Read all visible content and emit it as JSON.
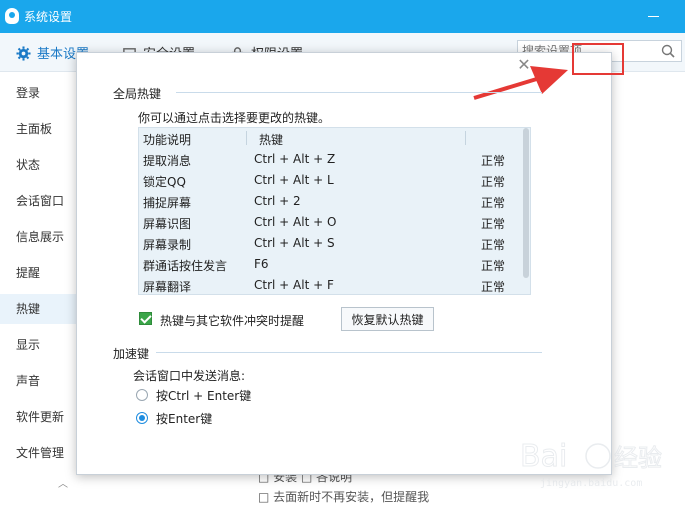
{
  "window": {
    "title": "系统设置"
  },
  "tabs": [
    {
      "label": "基本设置"
    },
    {
      "label": "安全设置"
    },
    {
      "label": "权限设置"
    }
  ],
  "search": {
    "placeholder": "搜索设置项"
  },
  "sidebar": {
    "items": [
      {
        "label": "登录"
      },
      {
        "label": "主面板"
      },
      {
        "label": "状态"
      },
      {
        "label": "会话窗口"
      },
      {
        "label": "信息展示"
      },
      {
        "label": "提醒"
      },
      {
        "label": "热键",
        "active": true
      },
      {
        "label": "显示"
      },
      {
        "label": "声音"
      },
      {
        "label": "软件更新"
      },
      {
        "label": "文件管理"
      }
    ]
  },
  "background": {
    "line1": "□ 安装 □ 各说明",
    "line2": "□ 去面新时不再安装，但提醒我"
  },
  "dialog": {
    "global_hotkeys_title": "全局热键",
    "hint": "你可以通过点击选择要更改的热键。",
    "table": {
      "headers": [
        "功能说明",
        "热键"
      ],
      "rows": [
        {
          "name": "提取消息",
          "key": "Ctrl + Alt + Z",
          "status": "正常"
        },
        {
          "name": "锁定QQ",
          "key": "Ctrl + Alt + L",
          "status": "正常"
        },
        {
          "name": "捕捉屏幕",
          "key": "Ctrl + 2",
          "status": "正常"
        },
        {
          "name": "屏幕识图",
          "key": "Ctrl + Alt + O",
          "status": "正常"
        },
        {
          "name": "屏幕录制",
          "key": "Ctrl + Alt + S",
          "status": "正常"
        },
        {
          "name": "群通话按住发言",
          "key": "F6",
          "status": "正常"
        },
        {
          "name": "屏幕翻译",
          "key": "Ctrl + Alt + F",
          "status": "正常"
        }
      ]
    },
    "conflict_checkbox": {
      "label": "热键与其它软件冲突时提醒",
      "checked": true
    },
    "restore_button": "恢复默认热键",
    "accel_title": "加速键",
    "send_label": "会话窗口中发送消息:",
    "radio_options": [
      {
        "label": "按Ctrl + Enter键",
        "selected": false
      },
      {
        "label": "按Enter键",
        "selected": true
      }
    ]
  },
  "colors": {
    "titlebar": "#1aa7ec",
    "accent": "#1f8de0",
    "highlight": "#e53935"
  }
}
